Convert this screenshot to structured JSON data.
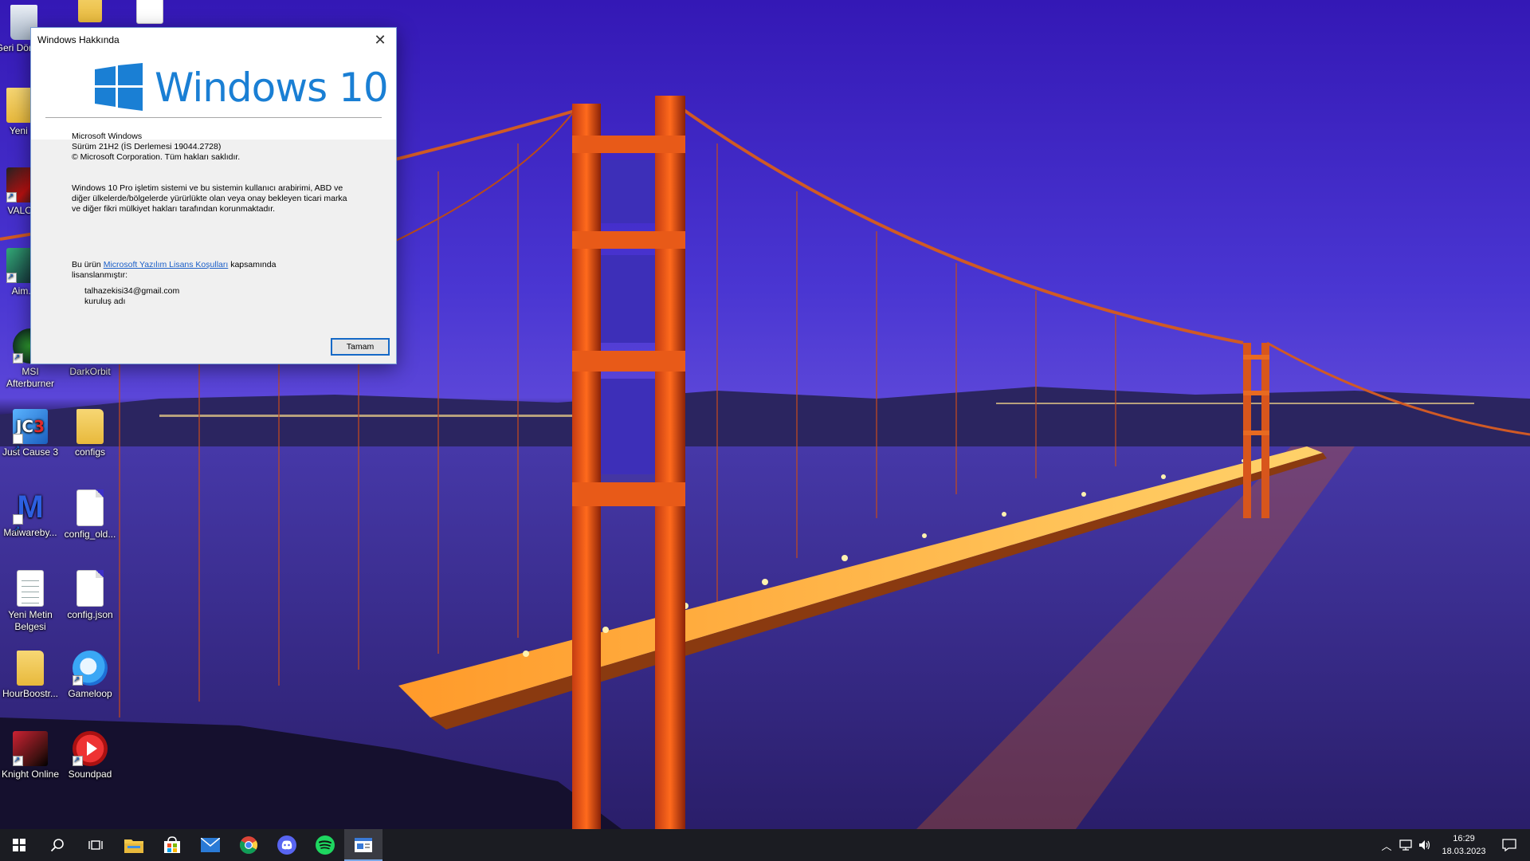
{
  "dialog": {
    "title": "Windows Hakkında",
    "logo_text": "Windows 10",
    "product": "Microsoft Windows",
    "version": "Sürüm 21H2 (İS Derlemesi 19044.2728)",
    "copyright": "© Microsoft Corporation. Tüm hakları saklıdır.",
    "description_1": "Windows 10 Pro işletim sistemi ve bu sistemin kullanıcı arabirimi, ABD ve",
    "description_2": "diğer ülkelerde/bölgelerde yürürlükte olan veya onay bekleyen ticari marka",
    "description_3": "ve diğer fikri mülkiyet hakları tarafından korunmaktadır.",
    "license_prefix": "Bu ürün ",
    "license_link": "Microsoft Yazılım Lisans Koşulları",
    "license_suffix": " kapsamında",
    "license_line2": "lisanslanmıştır:",
    "user": "talhazekisi34@gmail.com",
    "org": "kuruluş adı",
    "ok_label": "Tamam"
  },
  "desktop_icons": [
    {
      "label": "Geri Dönüş...",
      "type": "bin"
    },
    {
      "label": "Yeni ...",
      "type": "folder"
    },
    {
      "label": "VALO...",
      "type": "valo"
    },
    {
      "label": "Aim...",
      "type": "aim"
    },
    {
      "label": "MSI Afterburner",
      "type": "msi"
    },
    {
      "label": "DarkOrbit",
      "type": "doc"
    },
    {
      "label": "Just Cause 3",
      "type": "jc3"
    },
    {
      "label": "configs",
      "type": "folder"
    },
    {
      "label": "Malwareby...",
      "type": "mb"
    },
    {
      "label": "config_old...",
      "type": "doc"
    },
    {
      "label": "Yeni Metin Belgesi",
      "type": "docl"
    },
    {
      "label": "config.json",
      "type": "doc"
    },
    {
      "label": "HourBoostr...",
      "type": "folder"
    },
    {
      "label": "Gameloop",
      "type": "gl"
    },
    {
      "label": "Knight Online",
      "type": "ko"
    },
    {
      "label": "Soundpad",
      "type": "sp"
    }
  ],
  "taskbar": {
    "apps": [
      "start-button",
      "search",
      "task-view",
      "file-explorer",
      "microsoft-store",
      "mail",
      "chrome",
      "discord",
      "spotify",
      "about-windows"
    ],
    "time": "16:29",
    "date": "18.03.2023"
  },
  "colors": {
    "taskbar": "#1b1c22",
    "windows_blue": "#1a7fd4",
    "link": "#1b5fc8"
  }
}
